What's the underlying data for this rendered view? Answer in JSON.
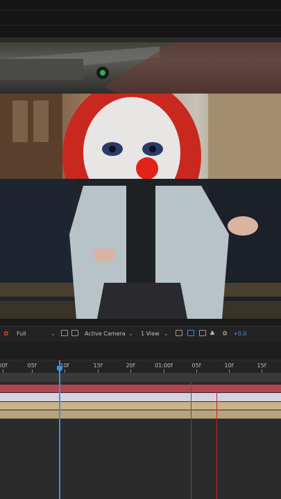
{
  "toolbar": {
    "resolution_value": "Full",
    "camera_value": "Active Camera",
    "view_value": "1 View",
    "exposure_value": "+0.0"
  },
  "timeline": {
    "ruler_labels": [
      "00f",
      "05f",
      "10f",
      "15f",
      "20f",
      "01:00f",
      "05f",
      "10f",
      "15f"
    ]
  },
  "colors": {
    "playhead": "#3d8fe6",
    "layer_red": "#b3444f",
    "layer_lavender": "#d6d2e2",
    "layer_tan": "#c8b38c",
    "marker_red": "#c3242f"
  },
  "icons": [
    "color-picker-icon",
    "resolution-dropdown-icon",
    "safe-area-icon",
    "grid-icon",
    "camera-dropdown-icon",
    "view-dropdown-icon",
    "fast-preview-icon",
    "transparency-grid-icon",
    "snapshot-icon",
    "show-channel-icon",
    "reset-exposure-icon"
  ]
}
